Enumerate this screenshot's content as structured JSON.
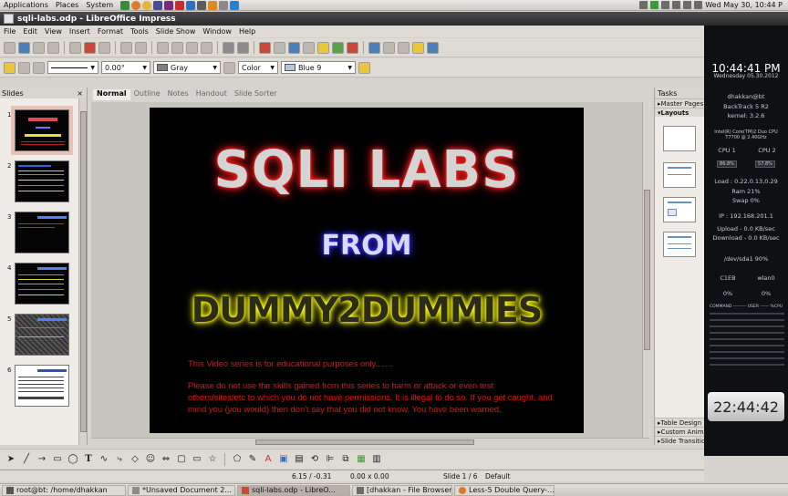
{
  "top_panel": {
    "menus": [
      "Applications",
      "Places",
      "System"
    ],
    "datetime": "Wed May 30, 10:44 P"
  },
  "window": {
    "title": "sqli-labs.odp - LibreOffice Impress"
  },
  "menubar": [
    "File",
    "Edit",
    "View",
    "Insert",
    "Format",
    "Tools",
    "Slide Show",
    "Window",
    "Help"
  ],
  "format_toolbar": {
    "rotation": "0.00°",
    "line_color": "Gray",
    "fill_type": "Color",
    "fill_color": "Blue 9"
  },
  "slides_pane": {
    "title": "Slides",
    "slides": [
      "1",
      "2",
      "3",
      "4",
      "5",
      "6"
    ]
  },
  "view_tabs": [
    "Normal",
    "Outline",
    "Notes",
    "Handout",
    "Slide Sorter"
  ],
  "slide": {
    "title": "SQLI LABS",
    "from": "FROM",
    "brand": "DUMMY2DUMMIES",
    "line1": "This Video series is for educational purposes only.......",
    "line2": "Please do not use the skills gained from this series to harm or attack or even test others/sites/etc  to which you do not have permissions. It is illegal to do so. If you get caught, and mind you (you would) then don't say that you did not know. You have been warned."
  },
  "tasks_pane": {
    "title": "Tasks",
    "sections": [
      "Master Pages",
      "Layouts"
    ],
    "bottom_sections": [
      "Table Design",
      "Custom Animation",
      "Slide Transition"
    ]
  },
  "conky": {
    "clock": "10:44:41 PM",
    "date": "Wednesday 05.30.2012",
    "user": "dhakkan@bt",
    "os": "BackTrack 5 R2",
    "kernel": "kernel: 3.2.6",
    "cpu_model": "Intel(R) Core(TM)2 Duo CPU T7700 @ 2.40GHz",
    "cpu1_label": "CPU 1",
    "cpu2_label": "CPU 2",
    "cpu1": "86.8%",
    "cpu2": "57.8%",
    "load": "Load : 0.22,0.13,0.29",
    "ram": "Ram 21%",
    "swap": "Swap 0%",
    "ip": "IP : 192.168.201.1",
    "upload": "Upload - 0.0 KB/sec",
    "download": "Download - 0.0 KB/sec",
    "disk": "/dev/sda1 90%",
    "c1": "C1EB",
    "c2": "wlan0",
    "c1v": "0%",
    "c2v": "0%",
    "proc_header": "COMMAND --------- USER ------ %CPU",
    "big_clock": "22:44:42",
    "big_clock_day": "Wednesday"
  },
  "statusbar": {
    "position": "6.15 / -0.31",
    "size": "0.00 x 0.00",
    "slide": "Slide 1 / 6",
    "layout": "Default"
  },
  "taskbar": [
    {
      "label": "root@bt: /home/dhakkan",
      "active": false
    },
    {
      "label": "*Unsaved Document 2...",
      "active": false
    },
    {
      "label": "sqli-labs.odp - LibreO...",
      "active": true
    },
    {
      "label": "[dhakkan - File Browser]",
      "active": false
    },
    {
      "label": "Less-5 Double Query-...",
      "active": false
    }
  ]
}
